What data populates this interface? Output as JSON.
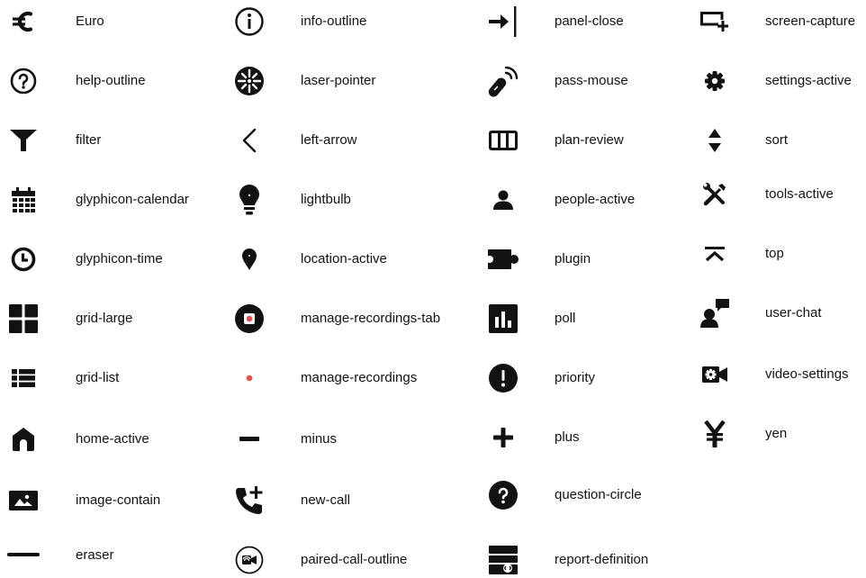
{
  "icons": [
    {
      "label": "Euro",
      "icon": "euro-icon"
    },
    {
      "label": "help-outline",
      "icon": "help-outline-icon"
    },
    {
      "label": "filter",
      "icon": "filter-icon"
    },
    {
      "label": "glyphicon-calendar",
      "icon": "calendar-icon"
    },
    {
      "label": "glyphicon-time",
      "icon": "clock-icon"
    },
    {
      "label": "grid-large",
      "icon": "grid-large-icon"
    },
    {
      "label": "grid-list",
      "icon": "grid-list-icon"
    },
    {
      "label": "home-active",
      "icon": "home-icon"
    },
    {
      "label": "image-contain",
      "icon": "image-icon"
    },
    {
      "label": "eraser",
      "icon": "eraser-icon"
    },
    {
      "label": "info-outline",
      "icon": "info-outline-icon"
    },
    {
      "label": "laser-pointer",
      "icon": "laser-pointer-icon"
    },
    {
      "label": "left-arrow",
      "icon": "left-arrow-icon"
    },
    {
      "label": "lightbulb",
      "icon": "lightbulb-icon"
    },
    {
      "label": "location-active",
      "icon": "location-pin-icon"
    },
    {
      "label": "manage-recordings-tab",
      "icon": "record-tab-icon"
    },
    {
      "label": "manage-recordings",
      "icon": "record-dot-icon"
    },
    {
      "label": "minus",
      "icon": "minus-icon"
    },
    {
      "label": "new-call",
      "icon": "new-call-icon"
    },
    {
      "label": "paired-call-outline",
      "icon": "paired-call-icon"
    },
    {
      "label": "panel-close",
      "icon": "panel-close-icon"
    },
    {
      "label": "pass-mouse",
      "icon": "pass-mouse-icon"
    },
    {
      "label": "plan-review",
      "icon": "plan-review-icon"
    },
    {
      "label": "people-active",
      "icon": "person-icon"
    },
    {
      "label": "plugin",
      "icon": "plugin-icon"
    },
    {
      "label": "poll",
      "icon": "poll-icon"
    },
    {
      "label": "priority",
      "icon": "priority-icon"
    },
    {
      "label": "plus",
      "icon": "plus-icon"
    },
    {
      "label": "question-circle",
      "icon": "question-circle-icon"
    },
    {
      "label": "report-definition",
      "icon": "report-definition-icon"
    },
    {
      "label": "screen-capture",
      "icon": "screen-capture-icon"
    },
    {
      "label": "settings-active",
      "icon": "gear-icon"
    },
    {
      "label": "sort",
      "icon": "sort-icon"
    },
    {
      "label": "tools-active",
      "icon": "tools-icon"
    },
    {
      "label": "top",
      "icon": "top-icon"
    },
    {
      "label": "user-chat",
      "icon": "user-chat-icon"
    },
    {
      "label": "video-settings",
      "icon": "video-settings-icon"
    },
    {
      "label": "yen",
      "icon": "yen-icon"
    }
  ],
  "colors": {
    "icon": "#121212",
    "recording": "#e5544e"
  }
}
